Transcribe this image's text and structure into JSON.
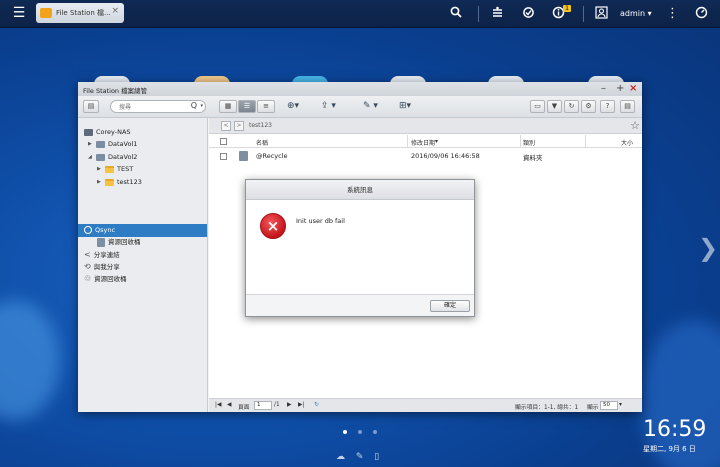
{
  "topbar": {
    "menu_icon": "hamburger-icon",
    "app_tab": {
      "label": "File Station 檔...",
      "icon": "folder-icon"
    },
    "right_icons": [
      "search-icon",
      "stack-icon",
      "sync-icon",
      "info-icon"
    ],
    "info_badge": "1",
    "user": "admin ▾",
    "more_icon": "vertical-dots-icon",
    "dashboard_icon": "gauge-icon"
  },
  "window": {
    "title": "File Station 檔案總管",
    "controls": {
      "minimize": "–",
      "maximize": "+",
      "close": "×"
    },
    "toolbar": {
      "search_placeholder": "搜尋",
      "search_icon": "Q",
      "search_dropdown": "▾"
    },
    "sidebar": {
      "items": [
        {
          "label": "Corey-NAS"
        },
        {
          "label": "DataVol1"
        },
        {
          "label": "DataVol2"
        },
        {
          "label": "TEST"
        },
        {
          "label": "test123"
        },
        {
          "label": "Qsync"
        },
        {
          "label": "資源回收桶"
        },
        {
          "label": "分享連結"
        },
        {
          "label": "與我分享"
        },
        {
          "label": "資源回收桶"
        }
      ]
    },
    "pathbar": {
      "path": "test123"
    },
    "table": {
      "headers": {
        "name": "名稱",
        "modified": "修改日期",
        "type": "類別",
        "size": "大小"
      },
      "rows": [
        {
          "name": "@Recycle",
          "modified": "2016/09/06 16:46:58",
          "type": "資料夾",
          "size": ""
        }
      ]
    },
    "statusbar": {
      "page_label": "頁面",
      "page_value": "1",
      "page_total": "/1",
      "summary": "顯示項目：1-1, 總共：1",
      "per_page_label": "顯示",
      "per_page_value": "50"
    }
  },
  "dialog": {
    "title": "系統訊息",
    "message": "Init user db fail",
    "ok_label": "確定"
  },
  "clock": {
    "time": "16:59",
    "date": "星期二, 9月 6 日"
  },
  "colors": {
    "accent": "#2e7dc4",
    "error": "#c4161c",
    "desktop": "#0f4fa9"
  }
}
